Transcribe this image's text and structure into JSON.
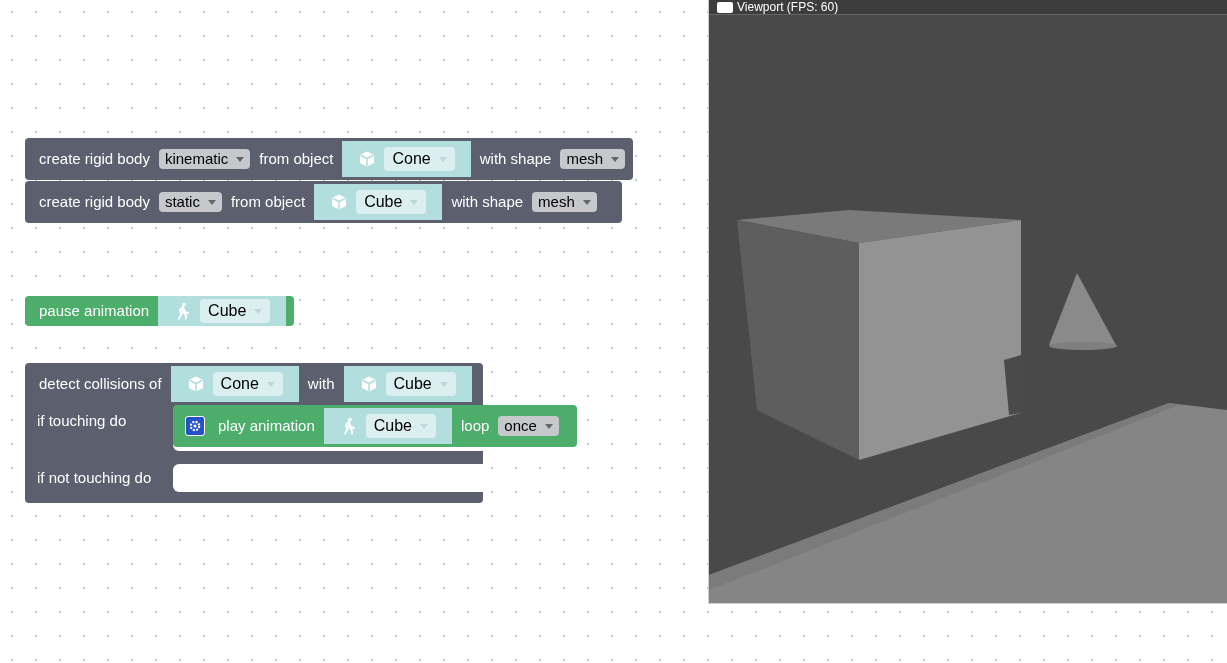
{
  "workspace": {
    "stacks": [
      {
        "blocks": [
          {
            "kind": "statement",
            "color": "#5b5f6e",
            "parts": [
              {
                "kind": "label",
                "text": "create rigid body"
              },
              {
                "kind": "dropdown",
                "value": "kinematic"
              },
              {
                "kind": "label",
                "text": "from object"
              },
              {
                "kind": "mesh_input",
                "value": "Cone"
              },
              {
                "kind": "label",
                "text": "with shape"
              },
              {
                "kind": "dropdown",
                "value": "mesh"
              }
            ]
          },
          {
            "kind": "statement",
            "color": "#5b5f6e",
            "parts": [
              {
                "kind": "label",
                "text": "create rigid body"
              },
              {
                "kind": "dropdown",
                "value": "static"
              },
              {
                "kind": "label",
                "text": "from object"
              },
              {
                "kind": "mesh_input",
                "value": "Cube"
              },
              {
                "kind": "label",
                "text": "with shape"
              },
              {
                "kind": "dropdown",
                "value": "mesh"
              }
            ]
          }
        ]
      },
      {
        "blocks": [
          {
            "kind": "statement",
            "color": "#4cae6a",
            "parts": [
              {
                "kind": "label",
                "text": "pause animation"
              },
              {
                "kind": "anim_input",
                "value": "Cube"
              }
            ]
          }
        ]
      },
      {
        "blocks": [
          {
            "kind": "collision",
            "color": "#5b5f6e",
            "parts": [
              {
                "kind": "label",
                "text": "detect collisions of"
              },
              {
                "kind": "mesh_input",
                "value": "Cone"
              },
              {
                "kind": "label",
                "text": "with"
              },
              {
                "kind": "mesh_input",
                "value": "Cube"
              }
            ],
            "branches": [
              {
                "label": "if touching do",
                "blocks": [
                  {
                    "kind": "statement",
                    "color": "#4cae6a",
                    "mutator": true,
                    "parts": [
                      {
                        "kind": "label",
                        "text": "play animation"
                      },
                      {
                        "kind": "anim_input",
                        "value": "Cube"
                      },
                      {
                        "kind": "label",
                        "text": "loop"
                      },
                      {
                        "kind": "dropdown",
                        "value": "once"
                      }
                    ]
                  }
                ]
              },
              {
                "label": "if not touching do"
              }
            ]
          }
        ]
      }
    ]
  },
  "viewport": {
    "title": "Viewport (FPS: 60)"
  }
}
